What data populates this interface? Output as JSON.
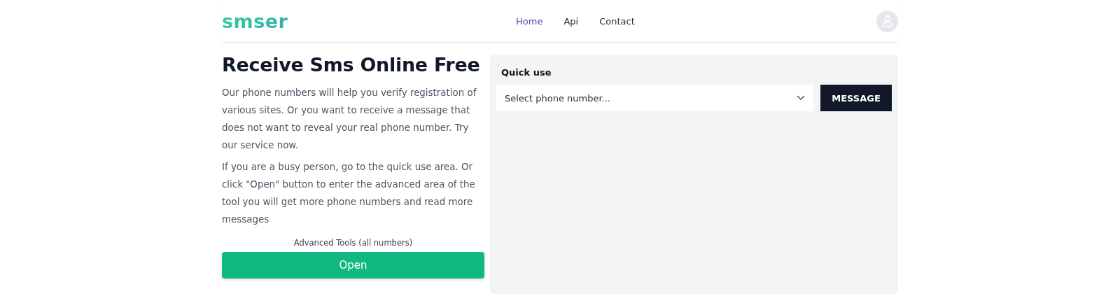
{
  "header": {
    "logo": "smser",
    "nav": [
      {
        "label": "Home",
        "selected": true
      },
      {
        "label": "Api",
        "selected": false
      },
      {
        "label": "Contact",
        "selected": false
      }
    ]
  },
  "intro": {
    "title": "Receive Sms Online Free",
    "paragraphs": [
      "Our phone numbers will help you verify registration of various sites. Or you want to receive a message that does not want to reveal your real phone number. Try our service now.",
      "If you are a busy person, go to the quick use area. Or click \"Open\" button to enter the advanced area of the tool you will get more phone numbers and read more messages"
    ],
    "advanced_label": "Advanced Tools (all numbers)",
    "open_button": "Open"
  },
  "quick_use": {
    "title": "Quick use",
    "select": {
      "placeholder": "Select phone number..."
    },
    "button": "MESSAGE"
  }
}
